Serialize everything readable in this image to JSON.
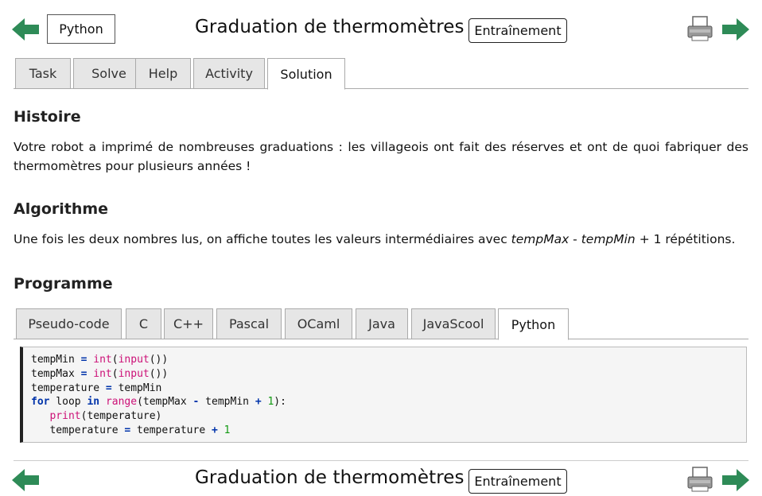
{
  "header": {
    "language_button": "Python",
    "title": "Graduation de thermomètres",
    "training_button": "Entraînement"
  },
  "tabs": [
    {
      "label": "Task"
    },
    {
      "label": "Solve"
    },
    {
      "label": "Help"
    },
    {
      "label": "Activity"
    },
    {
      "label": "Solution",
      "active": true
    }
  ],
  "sections": {
    "histoire": {
      "heading": "Histoire",
      "text": "Votre robot a imprimé de nombreuses graduations : les villageois ont fait des réserves et ont de quoi fabriquer des thermomètres pour plusieurs années !"
    },
    "algorithme": {
      "heading": "Algorithme",
      "text_before": "Une fois les deux nombres lus, on affiche toutes les valeurs intermédiaires avec ",
      "var1": "tempMax",
      "minus": " - ",
      "var2": "tempMin",
      "text_after": " + 1 répétitions."
    },
    "programme": {
      "heading": "Programme"
    }
  },
  "code_tabs": [
    {
      "label": "Pseudo-code"
    },
    {
      "label": "C"
    },
    {
      "label": "C++"
    },
    {
      "label": "Pascal"
    },
    {
      "label": "OCaml"
    },
    {
      "label": "Java"
    },
    {
      "label": "JavaScool"
    },
    {
      "label": "Python",
      "active": true
    }
  ],
  "code": {
    "l1": {
      "a": "tempMin ",
      "b": "=",
      "c": " ",
      "d": "int",
      "e": "(",
      "f": "input",
      "g": "())"
    },
    "l2": {
      "a": "tempMax ",
      "b": "=",
      "c": " ",
      "d": "int",
      "e": "(",
      "f": "input",
      "g": "())"
    },
    "l3": {
      "a": "temperature ",
      "b": "=",
      "c": " tempMin"
    },
    "l4": {
      "kw1": "for",
      "a": " loop ",
      "kw2": "in",
      "b": " ",
      "fn": "range",
      "c": "(tempMax ",
      "op1": "-",
      "d": " tempMin ",
      "op2": "+",
      "e": " ",
      "num": "1",
      "f": "):"
    },
    "l5": {
      "indent": "   ",
      "fn": "print",
      "a": "(temperature)"
    },
    "l6": {
      "indent": "   ",
      "a": "temperature ",
      "op1": "=",
      "b": " temperature ",
      "op2": "+",
      "c": " ",
      "num": "1"
    }
  },
  "colors": {
    "arrow_green": "#2e8b57",
    "keyword_blue": "#0033aa",
    "builtin_pink": "#cc1177",
    "number_green": "#119911"
  },
  "icons": [
    "arrow-left-icon",
    "arrow-right-icon",
    "printer-icon"
  ]
}
